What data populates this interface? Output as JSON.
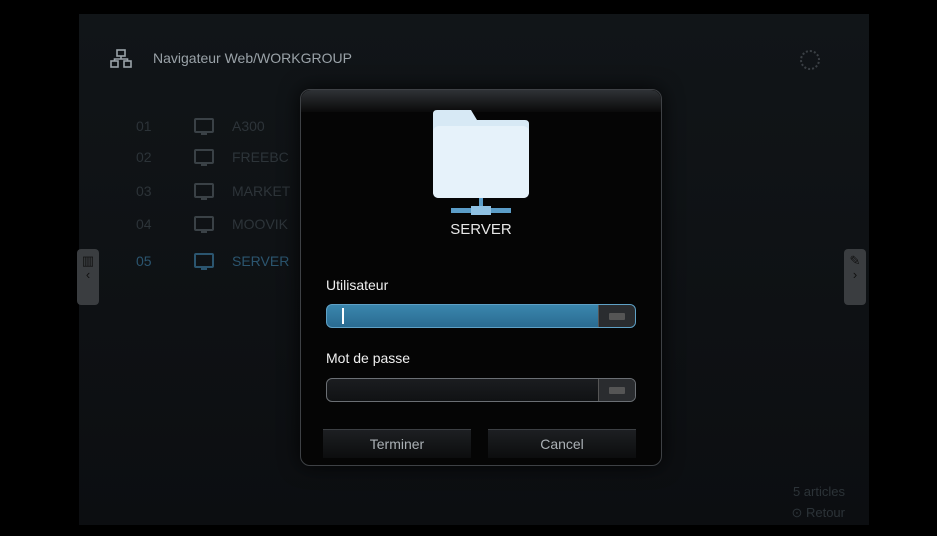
{
  "header": {
    "title": "Navigateur Web/WORKGROUP",
    "icon": "network-icon"
  },
  "list": [
    {
      "num": "01",
      "name": "A300"
    },
    {
      "num": "02",
      "name": "FREEBC"
    },
    {
      "num": "03",
      "name": "MARKET"
    },
    {
      "num": "04",
      "name": "MOOVIK"
    },
    {
      "num": "05",
      "name": "SERVER"
    }
  ],
  "selected_index": 4,
  "footer": {
    "count": "5 articles",
    "back": "Retour"
  },
  "dialog": {
    "server_name": "SERVER",
    "user_label": "Utilisateur",
    "user_value": "",
    "password_label": "Mot de passe",
    "password_value": "",
    "finish_label": "Terminer",
    "cancel_label": "Cancel"
  },
  "colors": {
    "accent": "#2f7aa3",
    "selected_text": "#2b556f"
  }
}
